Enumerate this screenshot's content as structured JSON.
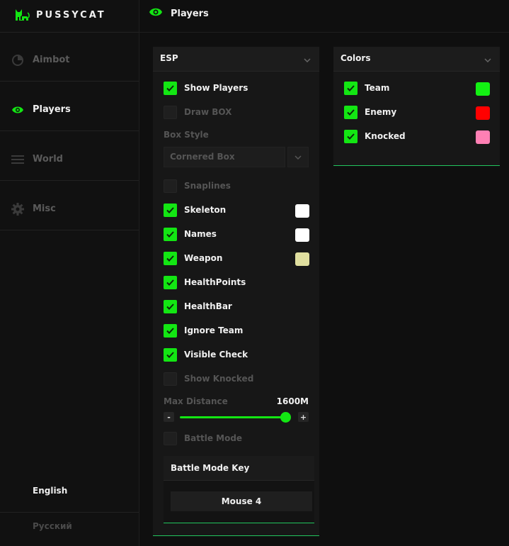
{
  "app": {
    "name": "PUSSYCAT"
  },
  "colors": {
    "accent": "#13e613",
    "dim_text": "#555555"
  },
  "sidebar": {
    "items": [
      {
        "label": "Aimbot",
        "icon": "pie-chart-icon",
        "active": false
      },
      {
        "label": "Players",
        "icon": "eye-icon",
        "active": true
      },
      {
        "label": "World",
        "icon": "menu-lines-icon",
        "active": false
      },
      {
        "label": "Misc",
        "icon": "gear-icon",
        "active": false
      }
    ],
    "languages": [
      {
        "label": "English",
        "active": true
      },
      {
        "label": "Русский",
        "active": false
      }
    ]
  },
  "header": {
    "title": "Players"
  },
  "esp": {
    "title": "ESP",
    "show_players": "Show Players",
    "draw_box": "Draw BOX",
    "box_style_label": "Box Style",
    "box_style_value": "Cornered Box",
    "snaplines": "Snaplines",
    "skeleton": "Skeleton",
    "names": "Names",
    "weapon": "Weapon",
    "health_points": "HealthPoints",
    "health_bar": "HealthBar",
    "ignore_team": "Ignore Team",
    "visible_check": "Visible Check",
    "show_knocked": "Show Knocked",
    "max_distance_label": "Max Distance",
    "max_distance_value": "1600M",
    "max_distance_fraction": 1.0,
    "minus": "-",
    "plus": "+",
    "battle_mode": "Battle Mode",
    "battle_mode_key_title": "Battle Mode Key",
    "battle_mode_key_value": "Mouse 4",
    "swatches": {
      "skeleton": "#ffffff",
      "names": "#ffffff",
      "weapon": "#e0df9f"
    }
  },
  "colors_panel": {
    "title": "Colors",
    "team": "Team",
    "enemy": "Enemy",
    "knocked": "Knocked",
    "swatches": {
      "team": "#13f013",
      "enemy": "#ff0000",
      "knocked": "#ff80b4"
    }
  }
}
